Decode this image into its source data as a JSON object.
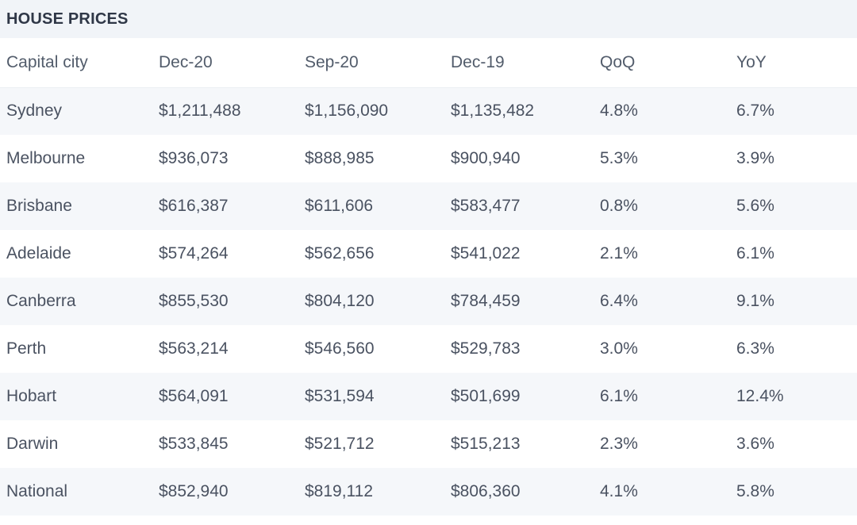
{
  "panel": {
    "title": "HOUSE PRICES",
    "accent_color": "#2f3747",
    "title_band_color": "#f1f4f8",
    "row_shade_color": "#f5f7fa",
    "text_color": "#4a5261"
  },
  "table": {
    "columns": [
      {
        "key": "city",
        "label": "Capital city"
      },
      {
        "key": "dec20",
        "label": "Dec-20"
      },
      {
        "key": "sep20",
        "label": "Sep-20"
      },
      {
        "key": "dec19",
        "label": "Dec-19"
      },
      {
        "key": "qoq",
        "label": "QoQ"
      },
      {
        "key": "yoy",
        "label": "YoY"
      }
    ],
    "rows": [
      {
        "city": "Sydney",
        "dec20": "$1,211,488",
        "sep20": "$1,156,090",
        "dec19": "$1,135,482",
        "qoq": "4.8%",
        "yoy": "6.7%"
      },
      {
        "city": "Melbourne",
        "dec20": "$936,073",
        "sep20": "$888,985",
        "dec19": "$900,940",
        "qoq": "5.3%",
        "yoy": "3.9%"
      },
      {
        "city": "Brisbane",
        "dec20": "$616,387",
        "sep20": "$611,606",
        "dec19": "$583,477",
        "qoq": "0.8%",
        "yoy": "5.6%"
      },
      {
        "city": "Adelaide",
        "dec20": "$574,264",
        "sep20": "$562,656",
        "dec19": "$541,022",
        "qoq": "2.1%",
        "yoy": "6.1%"
      },
      {
        "city": "Canberra",
        "dec20": "$855,530",
        "sep20": "$804,120",
        "dec19": "$784,459",
        "qoq": "6.4%",
        "yoy": "9.1%"
      },
      {
        "city": "Perth",
        "dec20": "$563,214",
        "sep20": "$546,560",
        "dec19": "$529,783",
        "qoq": "3.0%",
        "yoy": "6.3%"
      },
      {
        "city": "Hobart",
        "dec20": "$564,091",
        "sep20": "$531,594",
        "dec19": "$501,699",
        "qoq": "6.1%",
        "yoy": "12.4%"
      },
      {
        "city": "Darwin",
        "dec20": "$533,845",
        "sep20": "$521,712",
        "dec19": "$515,213",
        "qoq": "2.3%",
        "yoy": "3.6%"
      },
      {
        "city": "National",
        "dec20": "$852,940",
        "sep20": "$819,112",
        "dec19": "$806,360",
        "qoq": "4.1%",
        "yoy": "5.8%"
      }
    ]
  },
  "chart_data": {
    "type": "table",
    "title": "HOUSE PRICES",
    "columns": [
      "Capital city",
      "Dec-20",
      "Sep-20",
      "Dec-19",
      "QoQ",
      "YoY"
    ],
    "rows": [
      [
        "Sydney",
        1211488,
        1156090,
        1135482,
        4.8,
        6.7
      ],
      [
        "Melbourne",
        936073,
        888985,
        900940,
        5.3,
        3.9
      ],
      [
        "Brisbane",
        616387,
        611606,
        583477,
        0.8,
        5.6
      ],
      [
        "Adelaide",
        574264,
        562656,
        541022,
        2.1,
        6.1
      ],
      [
        "Canberra",
        855530,
        804120,
        784459,
        6.4,
        9.1
      ],
      [
        "Perth",
        563214,
        546560,
        529783,
        3.0,
        6.3
      ],
      [
        "Hobart",
        564091,
        531594,
        501699,
        6.1,
        12.4
      ],
      [
        "Darwin",
        533845,
        521712,
        515213,
        2.3,
        3.6
      ],
      [
        "National",
        852940,
        819112,
        806360,
        4.1,
        5.8
      ]
    ],
    "units": {
      "Dec-20": "AUD",
      "Sep-20": "AUD",
      "Dec-19": "AUD",
      "QoQ": "percent",
      "YoY": "percent"
    }
  }
}
